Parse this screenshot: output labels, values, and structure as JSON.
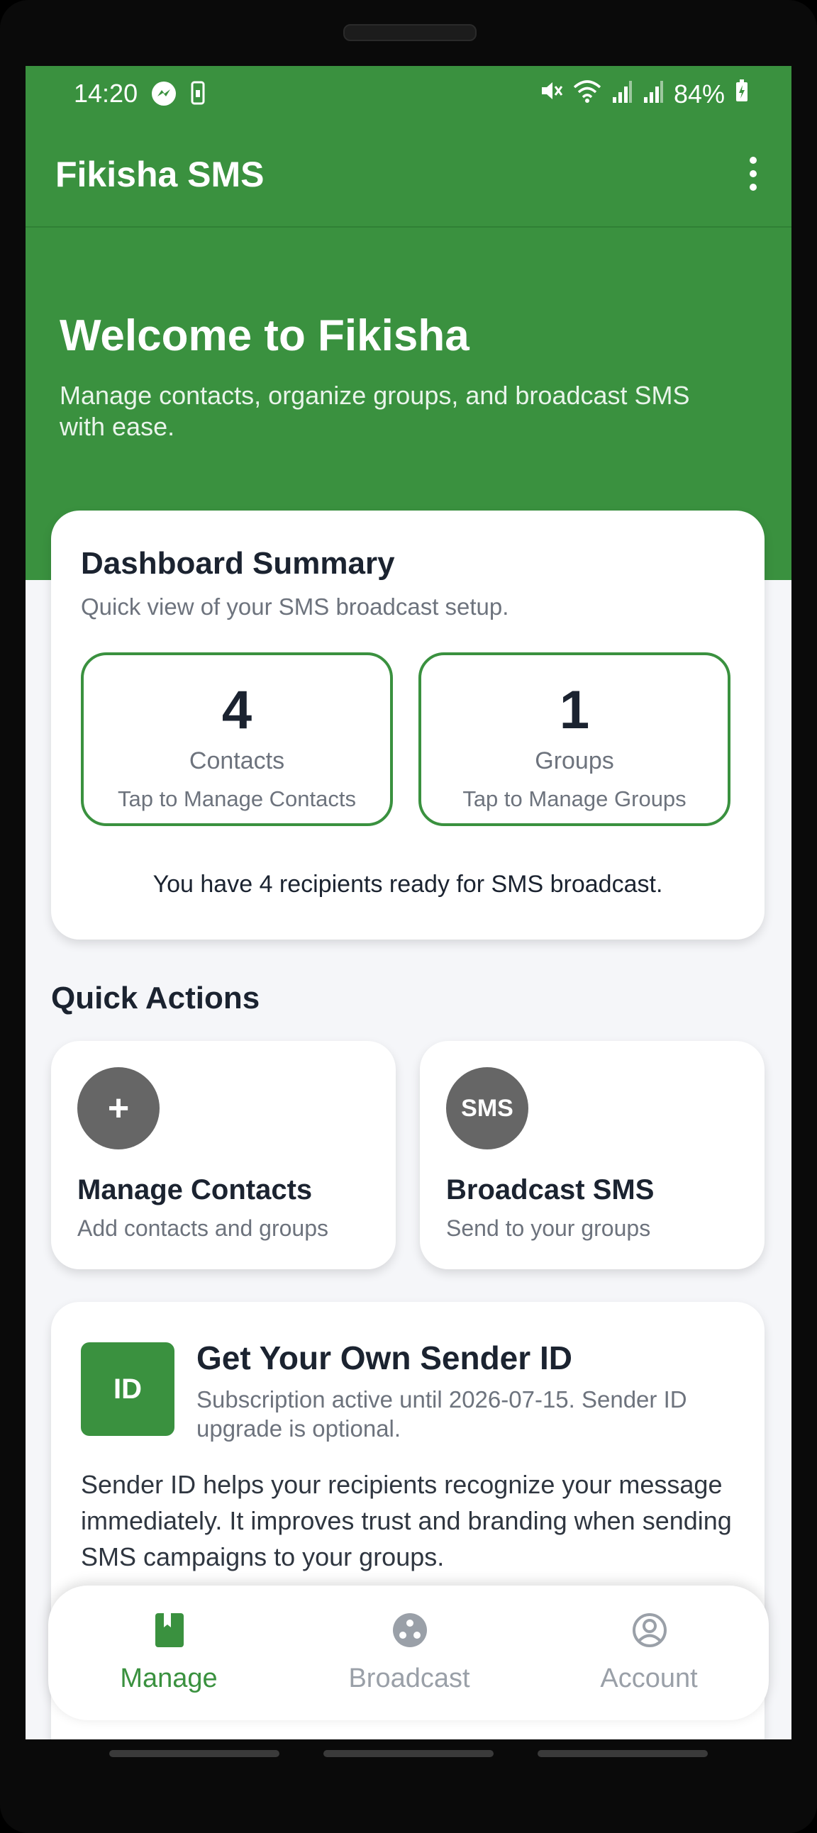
{
  "status_bar": {
    "time": "14:20",
    "battery": "84%",
    "left_icons": [
      "messenger-icon",
      "phone-icon"
    ],
    "right_icons": [
      "mute-icon",
      "wifi-icon",
      "signal-icon",
      "signal-icon",
      "battery-charging-icon"
    ]
  },
  "app_bar": {
    "title": "Fikisha SMS",
    "menu_icon": "more-vert-icon"
  },
  "hero": {
    "title": "Welcome to Fikisha",
    "subtitle": "Manage contacts, organize groups, and broadcast SMS with ease."
  },
  "summary": {
    "title": "Dashboard Summary",
    "subtitle": "Quick view of your SMS broadcast setup.",
    "contacts": {
      "count": "4",
      "label": "Contacts",
      "hint": "Tap to Manage Contacts"
    },
    "groups": {
      "count": "1",
      "label": "Groups",
      "hint": "Tap to Manage Groups"
    },
    "footer": "You have 4 recipients ready for SMS broadcast."
  },
  "quick_actions": {
    "title": "Quick Actions",
    "items": [
      {
        "icon_text": "+",
        "title": "Manage Contacts",
        "subtitle": "Add contacts and groups"
      },
      {
        "icon_text": "SMS",
        "title": "Broadcast SMS",
        "subtitle": "Send to your groups"
      }
    ]
  },
  "sender_id": {
    "badge": "ID",
    "title": "Get Your Own Sender ID",
    "subtitle": "Subscription active until 2026-07-15. Sender ID upgrade is optional.",
    "body": "Sender ID helps your recipients recognize your message immediately. It improves trust and branding when sending SMS campaigns to your groups."
  },
  "bottom_nav": {
    "items": [
      {
        "label": "Manage",
        "icon": "book-icon",
        "active": true
      },
      {
        "label": "Broadcast",
        "icon": "broadcast-icon",
        "active": false
      },
      {
        "label": "Account",
        "icon": "account-circle-icon",
        "active": false
      }
    ]
  },
  "colors": {
    "primary": "#3a913f",
    "text_dark": "#1b2330",
    "text_muted": "#6d737d",
    "nav_inactive": "#9aa0a8"
  }
}
